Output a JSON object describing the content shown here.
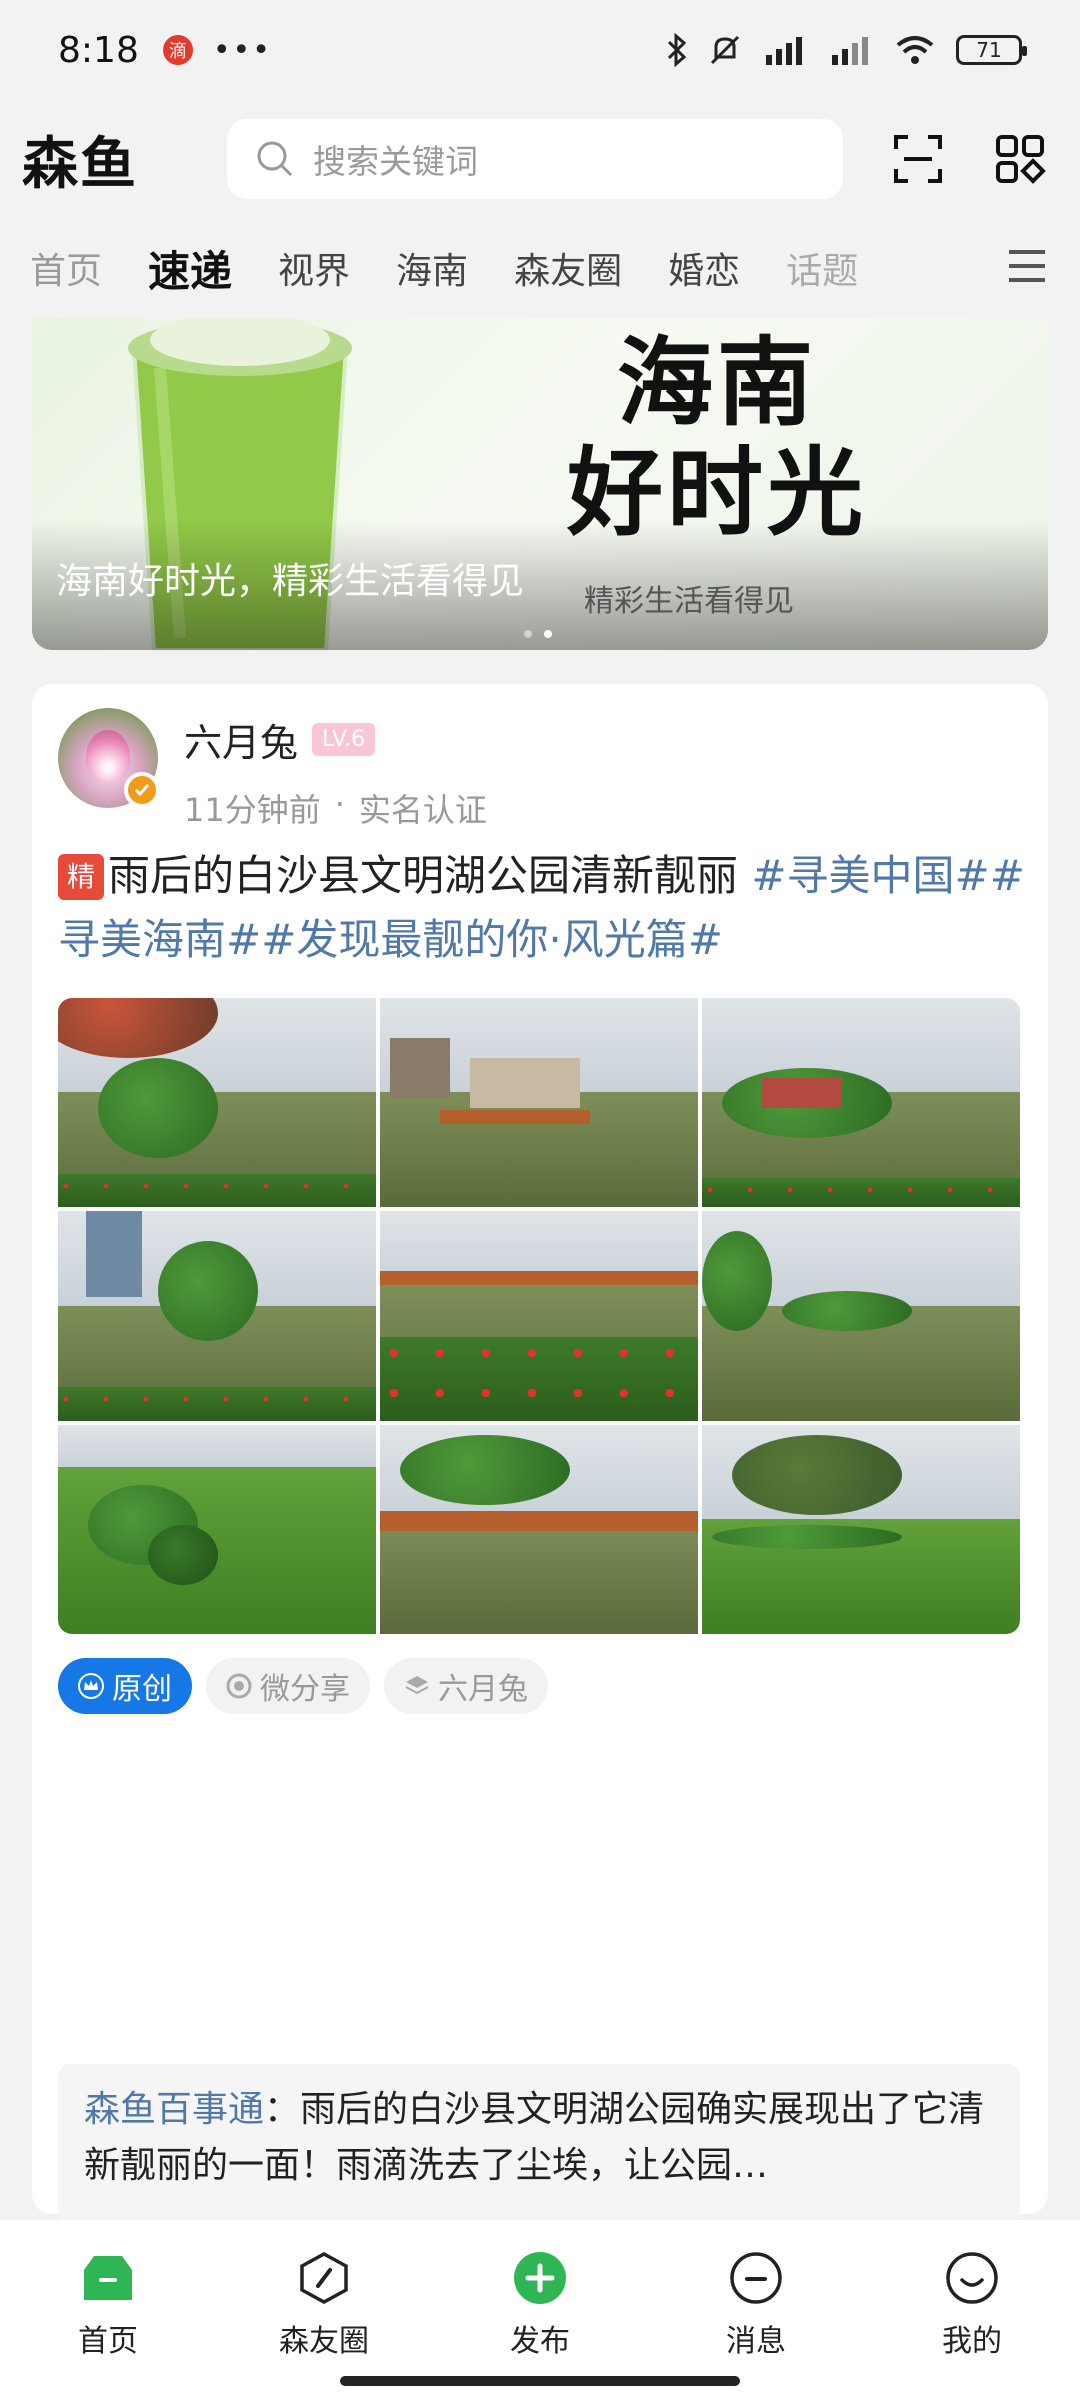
{
  "status_bar": {
    "time": "8:18",
    "battery": "71",
    "badge": "滴"
  },
  "header": {
    "logo": "森鱼",
    "search_placeholder": "搜索关键词"
  },
  "tabs": [
    "首页",
    "速递",
    "视界",
    "海南",
    "森友圈",
    "婚恋",
    "话题"
  ],
  "banner": {
    "big_line1": "海南",
    "big_line2": "好时光",
    "caption": "海南好时光，精彩生活看得见",
    "subcaption": "精彩生活看得见"
  },
  "post": {
    "author": "六月兔",
    "level": "LV.6",
    "time": "11分钟前",
    "verified": "实名认证",
    "badge": "精",
    "title": "雨后的白沙县文明湖公园清新靓丽",
    "tags": " #寻美中国##寻美海南##发现最靓的你·风光篇#",
    "pills": {
      "original": "原创",
      "share": "微分享",
      "author": "六月兔"
    },
    "comment_author": "森鱼百事通",
    "comment_text": "：雨后的白沙县文明湖公园确实展现出了它清新靓丽的一面！雨滴洗去了尘埃，让公园…"
  },
  "bottom_nav": [
    "首页",
    "森友圈",
    "发布",
    "消息",
    "我的"
  ],
  "colors": {
    "accent": "#2db653",
    "tag_blue": "#5079a9",
    "original_blue": "#1677e6"
  }
}
